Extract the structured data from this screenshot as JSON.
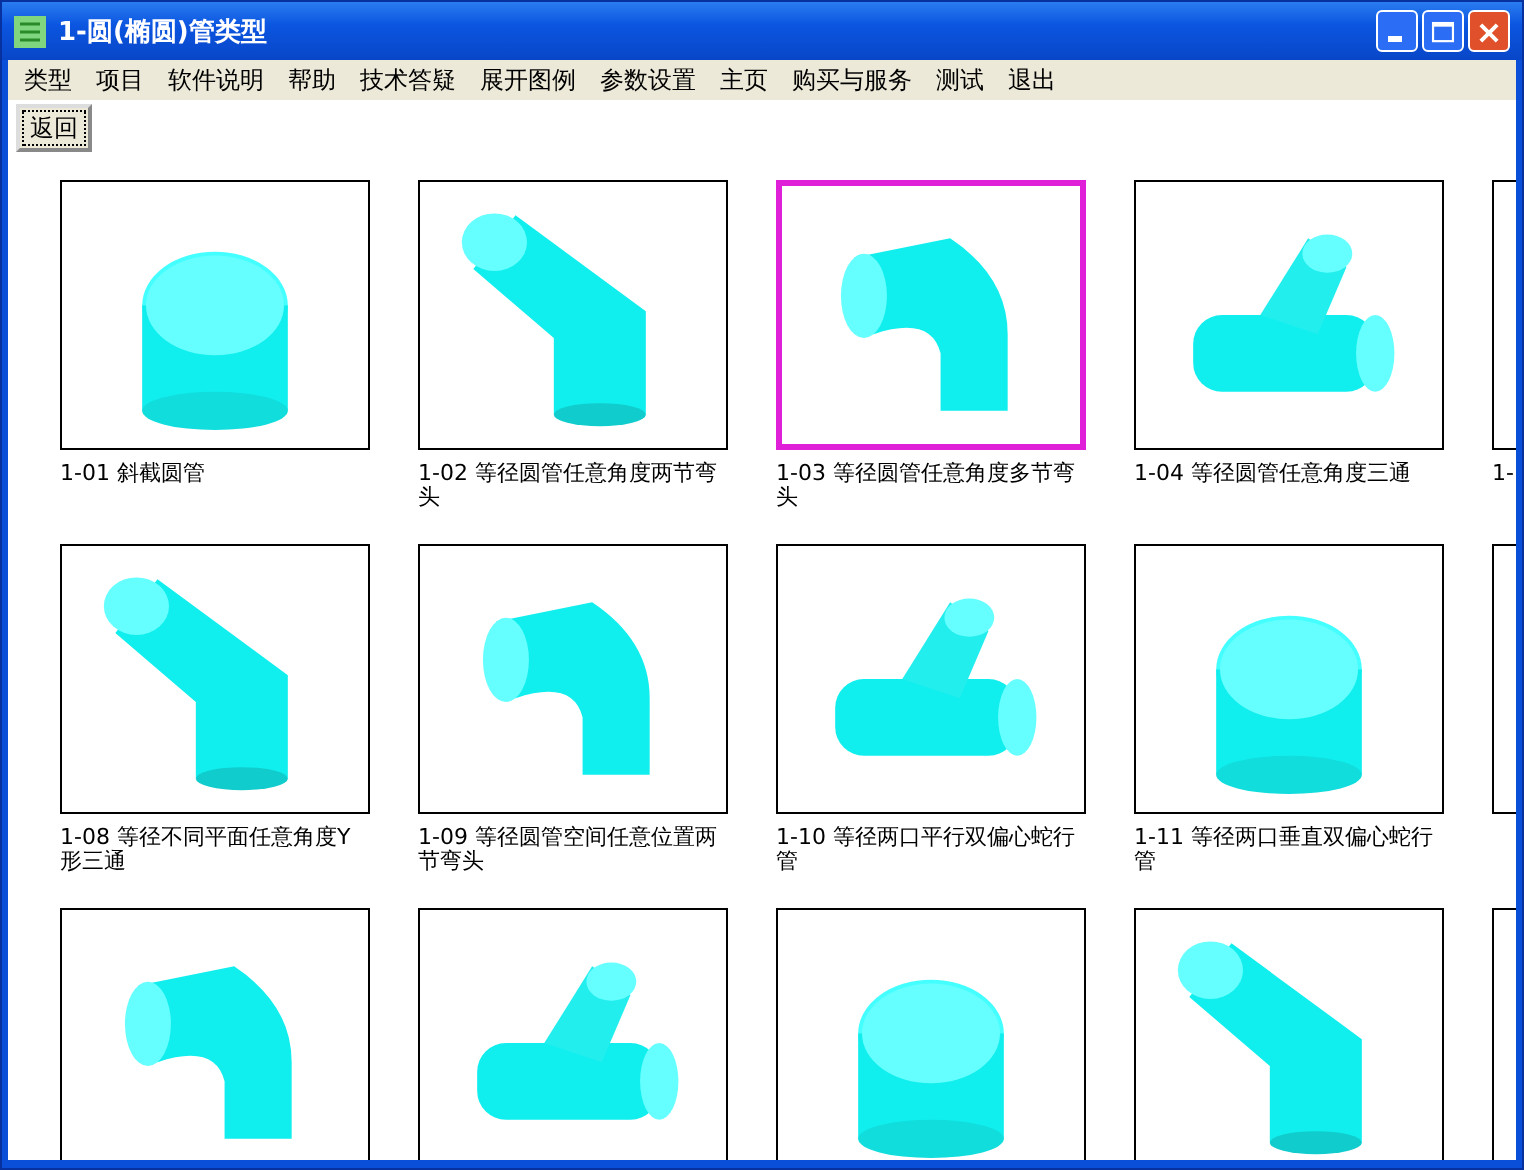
{
  "window": {
    "title": "1-圆(椭圆)管类型"
  },
  "menu": [
    "类型",
    "项目",
    "软件说明",
    "帮助",
    "技术答疑",
    "展开图例",
    "参数设置",
    "主页",
    "购买与服务",
    "测试",
    "退出"
  ],
  "toolbar": {
    "back_button": "返回"
  },
  "rows": [
    {
      "tiles": [
        {
          "label": "1-01 斜截圆管",
          "selected": false
        },
        {
          "label": "1-02 等径圆管任意角度两节弯头",
          "selected": false
        },
        {
          "label": "1-03 等径圆管任意角度多节弯头",
          "selected": true
        },
        {
          "label": "1-04 等径圆管任意角度三通",
          "selected": false
        },
        {
          "label": "1-",
          "selected": false
        }
      ]
    },
    {
      "tiles": [
        {
          "label": "1-08 等径不同平面任意角度Y形三通",
          "selected": false
        },
        {
          "label": "1-09 等径圆管空间任意位置两节弯头",
          "selected": false
        },
        {
          "label": "1-10 等径两口平行双偏心蛇行管",
          "selected": false
        },
        {
          "label": "1-11 等径两口垂直双偏心蛇行管",
          "selected": false
        },
        {
          "selected": false
        }
      ]
    },
    {
      "tiles": [
        {
          "selected": false
        },
        {
          "selected": false
        },
        {
          "selected": false
        },
        {
          "selected": false
        },
        {
          "selected": false
        }
      ]
    }
  ]
}
